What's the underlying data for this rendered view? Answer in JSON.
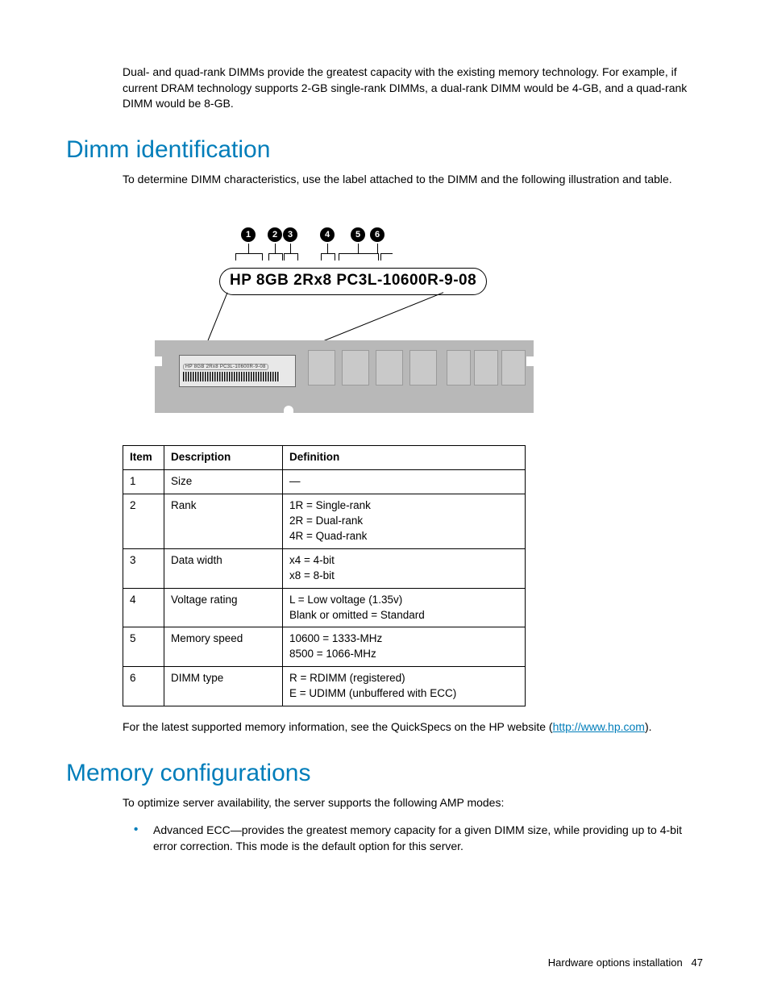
{
  "intro_para": "Dual- and quad-rank DIMMs provide the greatest capacity with the existing memory technology. For example, if current DRAM technology supports 2-GB single-rank DIMMs, a dual-rank DIMM would be 4-GB, and a quad-rank DIMM would be 8-GB.",
  "section1": {
    "heading": "Dimm identification",
    "para": "To determine DIMM characteristics, use the label attached to the DIMM and the following illustration and table."
  },
  "diagram": {
    "label_text": "HP 8GB 2Rx8 PC3L-10600R-9-08",
    "tiny_label": "HP 8GB 2Rx8 PC3L-10600R-9-08",
    "badges": [
      "1",
      "2",
      "3",
      "4",
      "5",
      "6"
    ]
  },
  "table": {
    "headers": [
      "Item",
      "Description",
      "Definition"
    ],
    "rows": [
      {
        "item": "1",
        "desc": "Size",
        "def": "—"
      },
      {
        "item": "2",
        "desc": "Rank",
        "def": "1R = Single-rank\n2R = Dual-rank\n4R = Quad-rank"
      },
      {
        "item": "3",
        "desc": "Data width",
        "def": "x4 = 4-bit\nx8 = 8-bit"
      },
      {
        "item": "4",
        "desc": "Voltage rating",
        "def": "L = Low voltage (1.35v)\nBlank or omitted = Standard"
      },
      {
        "item": "5",
        "desc": "Memory speed",
        "def": "10600 = 1333-MHz\n8500 = 1066-MHz"
      },
      {
        "item": "6",
        "desc": "DIMM type",
        "def": "R = RDIMM (registered)\nE = UDIMM (unbuffered with ECC)"
      }
    ]
  },
  "post_table": {
    "pre": "For the latest supported memory information, see the QuickSpecs on the HP website (",
    "link": "http://www.hp.com",
    "post": ")."
  },
  "section2": {
    "heading": "Memory configurations",
    "para": "To optimize server availability, the server supports the following AMP modes:",
    "bullets": [
      "Advanced ECC—provides the greatest memory capacity for a given DIMM size, while providing up to 4-bit error correction.   This mode is the default option for this server."
    ]
  },
  "footer": {
    "section": "Hardware options installation",
    "page": "47"
  }
}
